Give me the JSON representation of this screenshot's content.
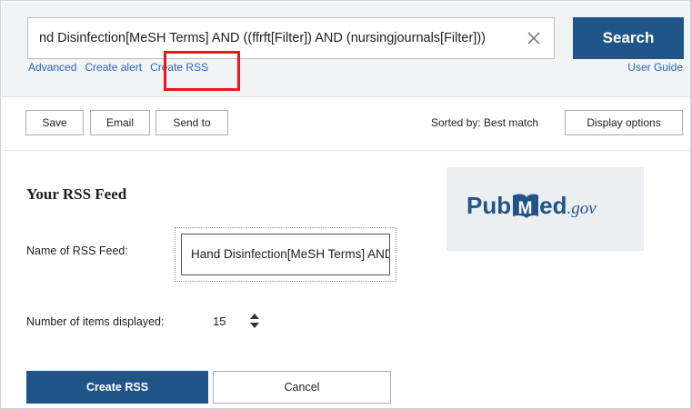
{
  "search": {
    "query": "nd Disinfection[MeSH Terms] AND ((ffrft[Filter]) AND (nursingjournals[Filter]))",
    "button_label": "Search",
    "links": [
      "Advanced",
      "Create alert",
      "Create RSS"
    ],
    "user_guide": "User Guide",
    "highlighted_link": "Create RSS",
    "highlight_color": "#e8181b"
  },
  "toolbar": {
    "buttons": [
      "Save",
      "Email",
      "Send to"
    ],
    "sorted_by": "Sorted by: Best match",
    "display_options": "Display options"
  },
  "rss": {
    "title": "Your RSS Feed",
    "name_label": "Name of RSS Feed:",
    "name_value": "Hand Disinfection[MeSH Terms] AND ((ffrft[Filter]) AND (nursingjournals[Filter]))",
    "count_label": "Number of items displayed:",
    "count_value": "15",
    "create_button": "Create RSS",
    "cancel_button": "Cancel"
  },
  "logo": {
    "pub": "Pub",
    "m": "M",
    "ed": "ed",
    "gov": ".gov"
  },
  "colors": {
    "brand_blue": "#20558a",
    "link_blue": "#2a67b1",
    "band_bg": "#f1f3f5"
  },
  "icons": {
    "clear": "close-icon",
    "stepper": "up-down-stepper-icon"
  }
}
